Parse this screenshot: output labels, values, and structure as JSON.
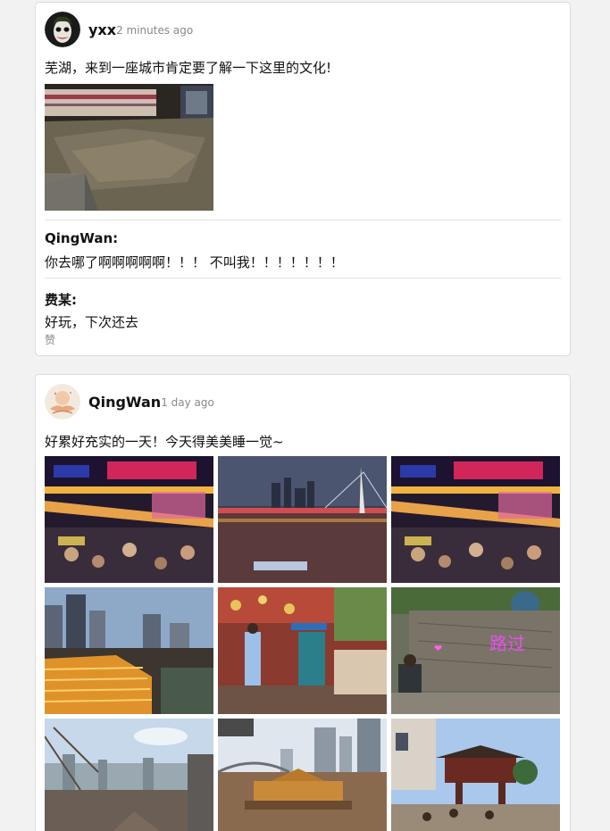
{
  "posts": [
    {
      "author": "yxx",
      "time": "2 minutes ago",
      "text": "芜湖，来到一座城市肯定要了解一下这里的文化!",
      "avatar_icon": "joker-avatar-icon",
      "photos": [
        "city-model-photo"
      ],
      "comments": [
        {
          "author": "QingWan:",
          "text": "你去哪了啊啊啊啊啊！！！ 不叫我！！！！！！！"
        },
        {
          "author": "费某:",
          "text": "好玩，下次还去"
        }
      ],
      "like_label": "赞"
    },
    {
      "author": "QingWan",
      "time": "1 day ago",
      "text": "好累好充实的一天！今天得美美睡一觉~",
      "avatar_icon": "illustrated-avatar-icon",
      "photos": [
        "night-street-photo",
        "night-bridge-photo",
        "night-street-photo",
        "skyline-hongyadong-photo",
        "red-ribbon-wall-photo",
        "neon-sign-stairs-photo",
        "hazy-cityscape-photo",
        "river-boat-photo",
        "temple-gate-photo"
      ]
    }
  ],
  "colors": {
    "username": "#111111",
    "timestamp": "#888888",
    "border": "#dcdcdc",
    "background": "#f2f2f2"
  }
}
